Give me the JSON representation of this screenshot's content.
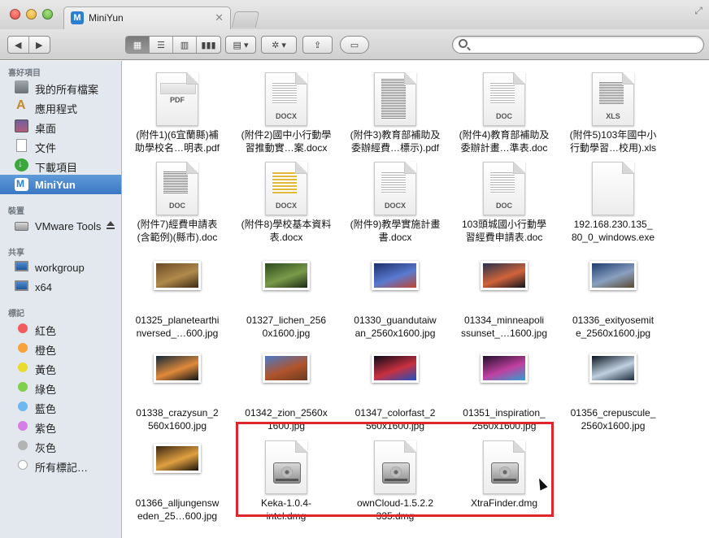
{
  "window": {
    "tab_title": "MiniYun",
    "tab_icon": "M",
    "tab_close": "✕",
    "fullscreen_glyph": "⤢"
  },
  "toolbar": {
    "back_glyph": "◀",
    "forward_glyph": "▶",
    "view_icon_glyph": "▦",
    "view_list_glyph": "☰",
    "view_column_glyph": "▥",
    "view_coverflow_glyph": "▮▮▮",
    "arrange_glyph": "▤ ▾",
    "action_glyph": "✲ ▾",
    "share_glyph": "⇪",
    "tags_glyph": "▭",
    "search_placeholder": "",
    "search_value": ""
  },
  "sidebar": {
    "sections": {
      "favorites": "喜好項目",
      "devices": "裝置",
      "shared": "共享",
      "tags": "標記"
    },
    "favorites": [
      {
        "label": "我的所有檔案",
        "icon": "all-files-icon"
      },
      {
        "label": "應用程式",
        "icon": "applications-icon"
      },
      {
        "label": "桌面",
        "icon": "desktop-icon"
      },
      {
        "label": "文件",
        "icon": "documents-icon"
      },
      {
        "label": "下載項目",
        "icon": "downloads-icon"
      },
      {
        "label": "MiniYun",
        "icon": "miniyun-icon",
        "selected": true
      }
    ],
    "devices": [
      {
        "label": "VMware Tools",
        "icon": "drive-icon"
      }
    ],
    "shared": [
      {
        "label": "workgroup",
        "icon": "network-computer-icon"
      },
      {
        "label": "x64",
        "icon": "network-computer-icon"
      }
    ],
    "tags": [
      {
        "label": "紅色",
        "color": "#f25b5b"
      },
      {
        "label": "橙色",
        "color": "#f7a23a"
      },
      {
        "label": "黃色",
        "color": "#e8dc2c"
      },
      {
        "label": "綠色",
        "color": "#7fd04a"
      },
      {
        "label": "藍色",
        "color": "#6cb8f0"
      },
      {
        "label": "紫色",
        "color": "#d67ee6"
      },
      {
        "label": "灰色",
        "color": "#b3b3b3"
      },
      {
        "label": "所有標記…",
        "color": "#ffffff"
      }
    ]
  },
  "files": [
    {
      "name": "(附件1)(6宜蘭縣)補\n助學校名…明表.pdf",
      "kind": "doc",
      "ext": "PDF"
    },
    {
      "name": "(附件2)國中小行動學\n習推動實…案.docx",
      "kind": "doc",
      "ext": "DOCX"
    },
    {
      "name": "(附件3)教育部補助及\n委辦經費…標示).pdf",
      "kind": "doc",
      "ext": ""
    },
    {
      "name": "(附件4)教育部補助及\n委辦計畫…準表.doc",
      "kind": "doc",
      "ext": "DOC"
    },
    {
      "name": "(附件5)103年國中小\n行動學習…校用).xls",
      "kind": "doc",
      "ext": "XLS"
    },
    {
      "name": "(附件7)經費申請表\n(含範例)(縣市).doc",
      "kind": "doc",
      "ext": "DOC"
    },
    {
      "name": "(附件8)學校基本資料\n表.docx",
      "kind": "doc",
      "ext": "DOCX"
    },
    {
      "name": "(附件9)教學實施計畫\n書.docx",
      "kind": "doc",
      "ext": "DOCX"
    },
    {
      "name": "103頭城國小行動學\n習經費申請表.doc",
      "kind": "doc",
      "ext": "DOC"
    },
    {
      "name": "192.168.230.135_\n80_0_windows.exe",
      "kind": "doc",
      "ext": ""
    },
    {
      "name": "01325_planetearthi\nnversed_…600.jpg",
      "kind": "image",
      "colors": [
        "#6b4a24",
        "#b08a4c",
        "#3c2a16"
      ]
    },
    {
      "name": "01327_lichen_256\n0x1600.jpg",
      "kind": "image",
      "colors": [
        "#2e4a1c",
        "#7a9a4a",
        "#1c2a12"
      ]
    },
    {
      "name": "01330_guandutaiw\nan_2560x1600.jpg",
      "kind": "image",
      "colors": [
        "#1c2f6a",
        "#5a7ad0",
        "#c0452f"
      ]
    },
    {
      "name": "01334_minneapoli\nssunset_…1600.jpg",
      "kind": "image",
      "colors": [
        "#26304e",
        "#d0643a",
        "#10141e"
      ]
    },
    {
      "name": "01336_exityosemit\ne_2560x1600.jpg",
      "kind": "image",
      "colors": [
        "#1e3c6e",
        "#8aa0c0",
        "#5a4a32"
      ]
    },
    {
      "name": "01338_crazysun_2\n560x1600.jpg",
      "kind": "image",
      "colors": [
        "#102838",
        "#e08a3a",
        "#0a1218"
      ]
    },
    {
      "name": "01342_zion_2560x\n1600.jpg",
      "kind": "image",
      "colors": [
        "#4a7ac8",
        "#b0542c",
        "#6a3a1c"
      ]
    },
    {
      "name": "01347_colorfast_2\n560x1600.jpg",
      "kind": "image",
      "colors": [
        "#0a0a18",
        "#c83040",
        "#2050c0"
      ]
    },
    {
      "name": "01351_inspiration_\n2560x1600.jpg",
      "kind": "image",
      "colors": [
        "#20102a",
        "#c040a0",
        "#30a0d0"
      ]
    },
    {
      "name": "01356_crepuscule_\n2560x1600.jpg",
      "kind": "image",
      "colors": [
        "#0a1420",
        "#c0d0e0",
        "#1a2a3a"
      ]
    },
    {
      "name": "01366_alljungensw\neden_25…600.jpg",
      "kind": "image",
      "colors": [
        "#3a2410",
        "#e0a040",
        "#1a120a"
      ]
    },
    {
      "name": "Keka-1.0.4-\nintel.dmg",
      "kind": "dmg"
    },
    {
      "name": "ownCloud-1.5.2.2\n335.dmg",
      "kind": "dmg"
    },
    {
      "name": "XtraFinder.dmg",
      "kind": "dmg"
    }
  ]
}
